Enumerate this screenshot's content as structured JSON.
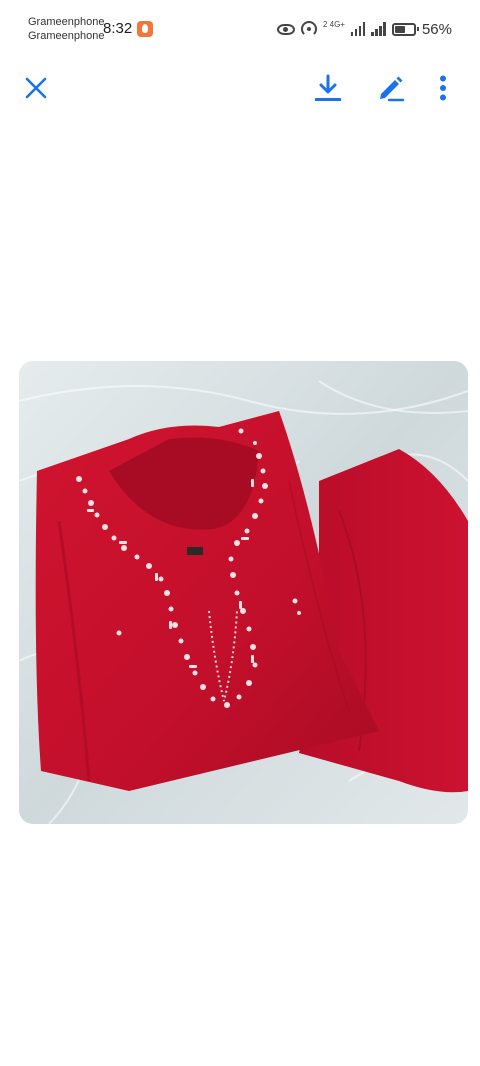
{
  "status_bar": {
    "carrier_1": "Grameenphone",
    "carrier_2": "Grameenphone",
    "time": "8:32",
    "network_label": "2 4G+",
    "battery_percent": "56%"
  },
  "toolbar": {
    "close_icon": "close-icon",
    "download_icon": "download-icon",
    "edit_icon": "edit-pencil-icon",
    "more_icon": "more-vertical-icon"
  },
  "colors": {
    "accent": "#1a73e8",
    "garment": "#c8102e",
    "background": "#ffffff"
  },
  "image": {
    "subject": "red embroidered kurta with matching trousers on white tulle"
  }
}
